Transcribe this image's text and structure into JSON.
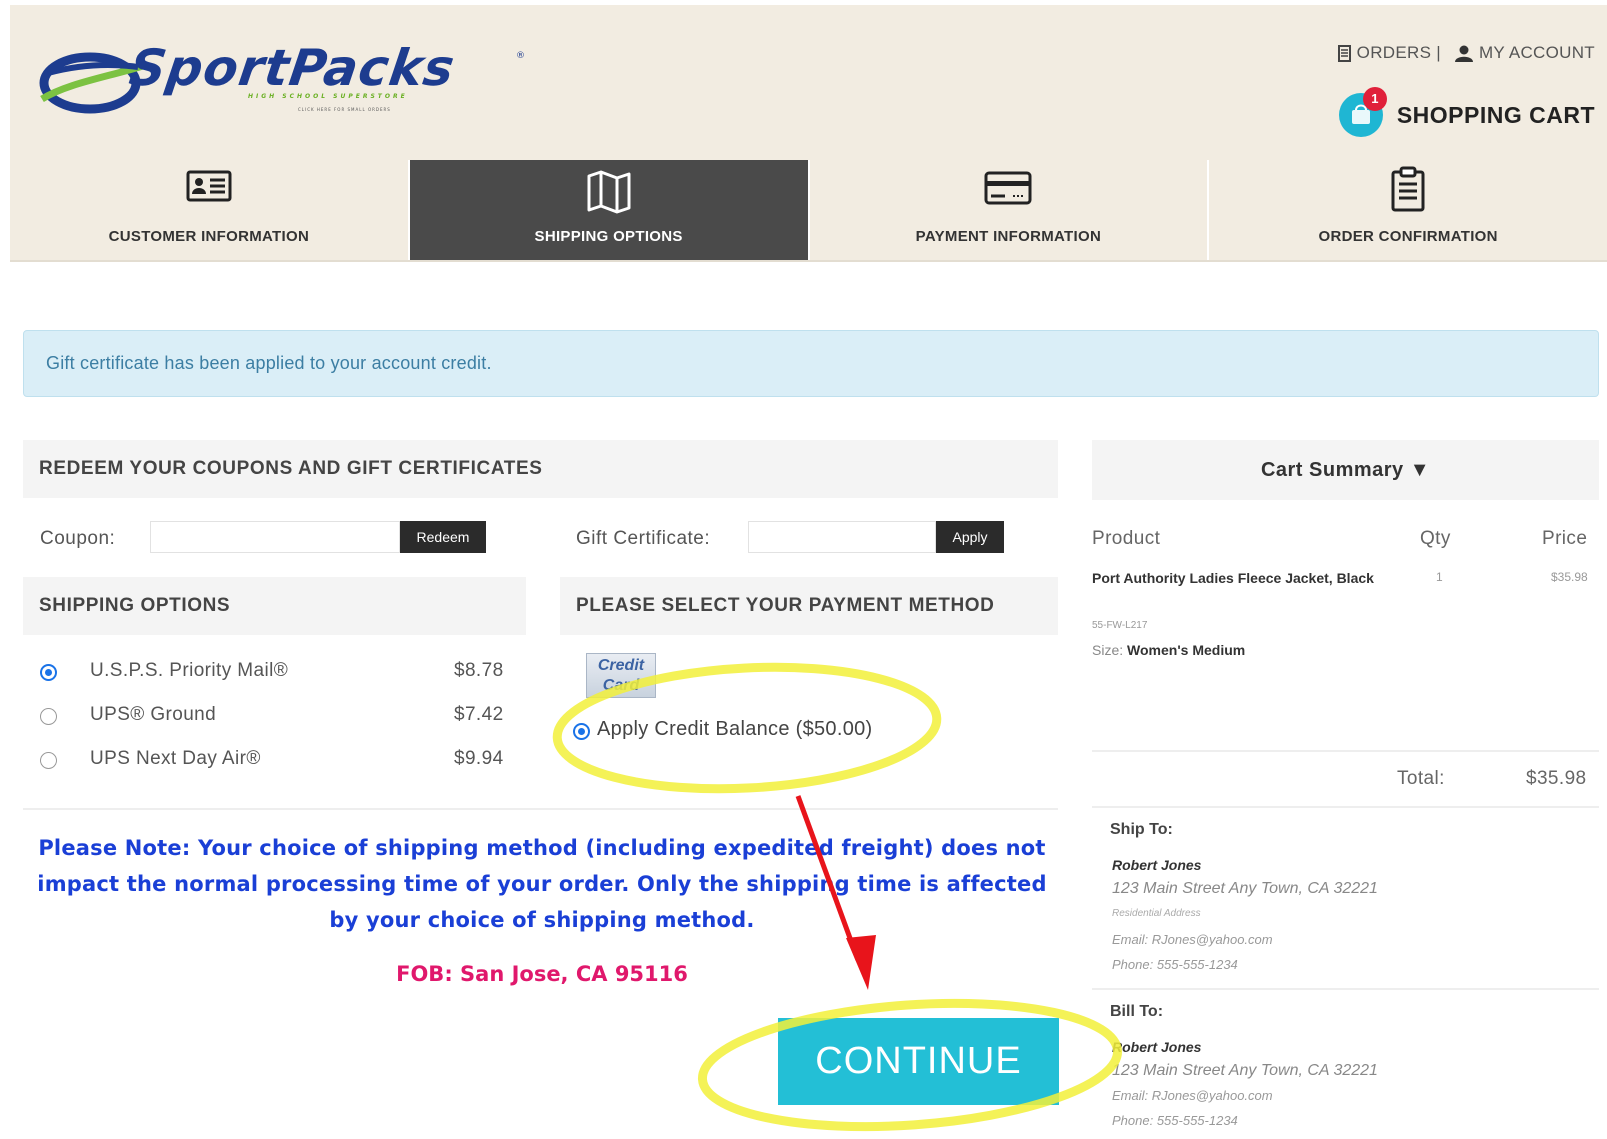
{
  "header": {
    "logo_text": "SportPacks",
    "logo_reg": "®",
    "logo_tagline": "HIGH SCHOOL SUPERSTORE",
    "logo_sub": "CLICK HERE FOR SMALL ORDERS",
    "orders_link": "ORDERS |",
    "account_link": "MY ACCOUNT",
    "cart_label": "SHOPPING CART",
    "cart_count": "1"
  },
  "steps": [
    {
      "label": "CUSTOMER INFORMATION",
      "icon": "id-card-icon",
      "active": false
    },
    {
      "label": "SHIPPING OPTIONS",
      "icon": "map-icon",
      "active": true
    },
    {
      "label": "PAYMENT INFORMATION",
      "icon": "credit-card-icon",
      "active": false
    },
    {
      "label": "ORDER CONFIRMATION",
      "icon": "clipboard-icon",
      "active": false
    }
  ],
  "alert": {
    "text": "Gift certificate has been applied to your account credit."
  },
  "redeem": {
    "heading": "REDEEM YOUR COUPONS AND GIFT CERTIFICATES",
    "coupon_label": "Coupon:",
    "coupon_value": "",
    "redeem_button": "Redeem",
    "gift_label": "Gift Certificate:",
    "gift_value": "",
    "apply_button": "Apply"
  },
  "shipping": {
    "heading": "SHIPPING OPTIONS",
    "options": [
      {
        "name": "U.S.P.S. Priority Mail®",
        "price": "$8.78",
        "selected": true
      },
      {
        "name": "UPS® Ground",
        "price": "$7.42",
        "selected": false
      },
      {
        "name": "UPS Next Day Air®",
        "price": "$9.94",
        "selected": false
      }
    ]
  },
  "payment": {
    "heading": "PLEASE SELECT YOUR PAYMENT METHOD",
    "credit_card_line1": "Credit",
    "credit_card_line2": "Card",
    "credit_balance_label": "Apply Credit Balance ($50.00)"
  },
  "note": {
    "text": "Please Note: Your choice of shipping method (including expedited freight) does not impact the normal processing time of your order. Only the shipping time is affected by your choice of shipping method.",
    "fob": "FOB: San Jose, CA 95116"
  },
  "continue_button": "CONTINUE",
  "cart_summary": {
    "heading": "Cart Summary ▼",
    "col_product": "Product",
    "col_qty": "Qty",
    "col_price": "Price",
    "product_name": "Port Authority Ladies Fleece Jacket, Black",
    "product_sku": "55-FW-L217",
    "size_label": "Size:",
    "size_value": "Women's Medium",
    "qty": "1",
    "price": "$35.98",
    "total_label": "Total:",
    "total_value": "$35.98"
  },
  "ship_to": {
    "heading": "Ship To:",
    "name": "Robert Jones",
    "address": "123 Main Street  Any Town, CA 32221",
    "type": "Residential Address",
    "email": "Email:  RJones@yahoo.com",
    "phone": "Phone:  555-555-1234"
  },
  "bill_to": {
    "heading": "Bill To:",
    "name": "Robert Jones",
    "address": "123 Main Street  Any Town, CA 32221",
    "email": "Email:  RJones@yahoo.com",
    "phone": "Phone:  555-555-1234"
  },
  "colors": {
    "accent_cyan": "#23bfd6",
    "step_active_bg": "#4a4a4a",
    "header_bg": "#f2ece1",
    "note_blue": "#1a3fd6",
    "fob_pink": "#e0186c",
    "highlight_yellow": "#f2f03a",
    "arrow_red": "#e8141b"
  }
}
